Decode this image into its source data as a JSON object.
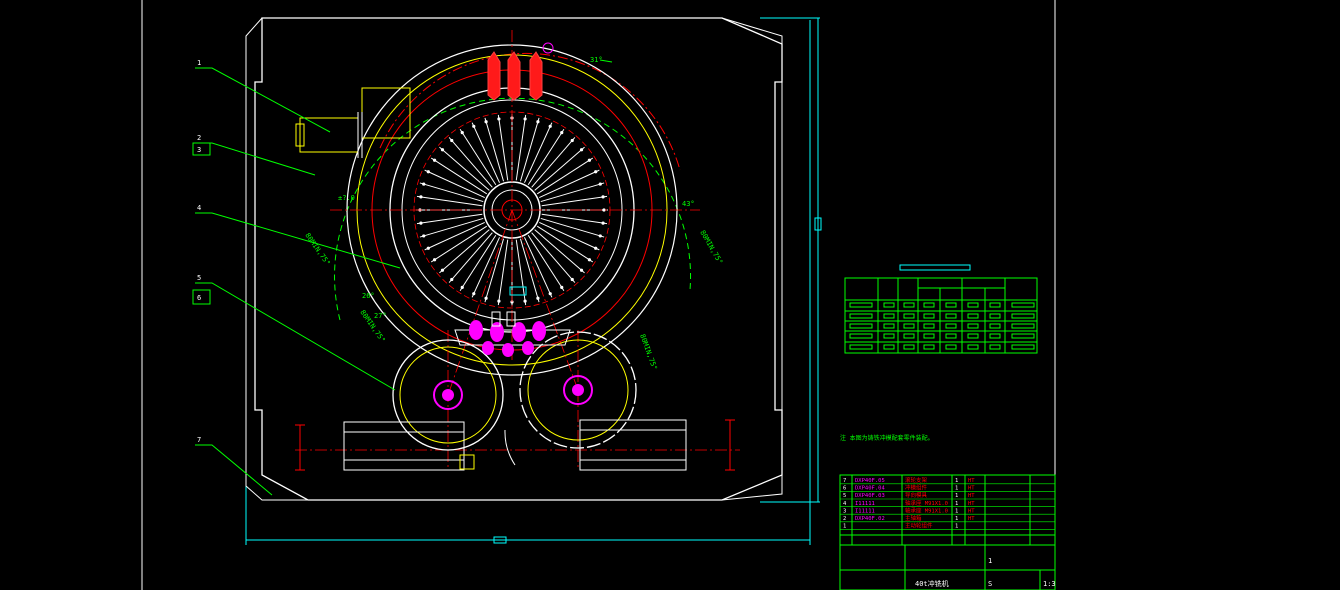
{
  "drawing": {
    "note": "注  本图为铸铁冲模配套零件装配。",
    "scale": "1:3",
    "title_block": {
      "title": "40t冲铣机",
      "sheet": "S",
      "sheet_no": "1"
    }
  },
  "leaders": [
    "1",
    "2",
    "3",
    "4",
    "5",
    "6",
    "7"
  ],
  "dims": [
    "±?.0",
    "31°",
    "27°",
    "43°",
    "26°"
  ],
  "bom_rows": [
    {
      "no": "7",
      "code": "DXP40F.05",
      "name": "滚轮支架",
      "qty": "1",
      "mat": "HT"
    },
    {
      "no": "6",
      "code": "DXP40F.04",
      "name": "冲模组件",
      "qty": "1",
      "mat": "HT"
    },
    {
      "no": "5",
      "code": "DXP40F.03",
      "name": "导向模具",
      "qty": "1",
      "mat": "HT"
    },
    {
      "no": "4",
      "code": "I11111",
      "name": "轴承座 M91X1.0",
      "qty": "1",
      "mat": "HT"
    },
    {
      "no": "3",
      "code": "I11111",
      "name": "轴承座 M91X1.0",
      "qty": "1",
      "mat": "HT"
    },
    {
      "no": "2",
      "code": "DXP40F.02",
      "name": "主轴箱",
      "qty": "1",
      "mat": "HT"
    },
    {
      "no": "1",
      "code": "",
      "name": "主动轮组件",
      "qty": "1",
      "mat": ""
    }
  ],
  "colors": {
    "background": "#000000",
    "frame": "#ffffff",
    "dimension": "#00ffff",
    "centerline": "#ff0000",
    "part": "#ffffff",
    "hidden": "#ffff00",
    "leader": "#00ff00",
    "punch": "#ff00ff",
    "table": "#00ff00"
  }
}
